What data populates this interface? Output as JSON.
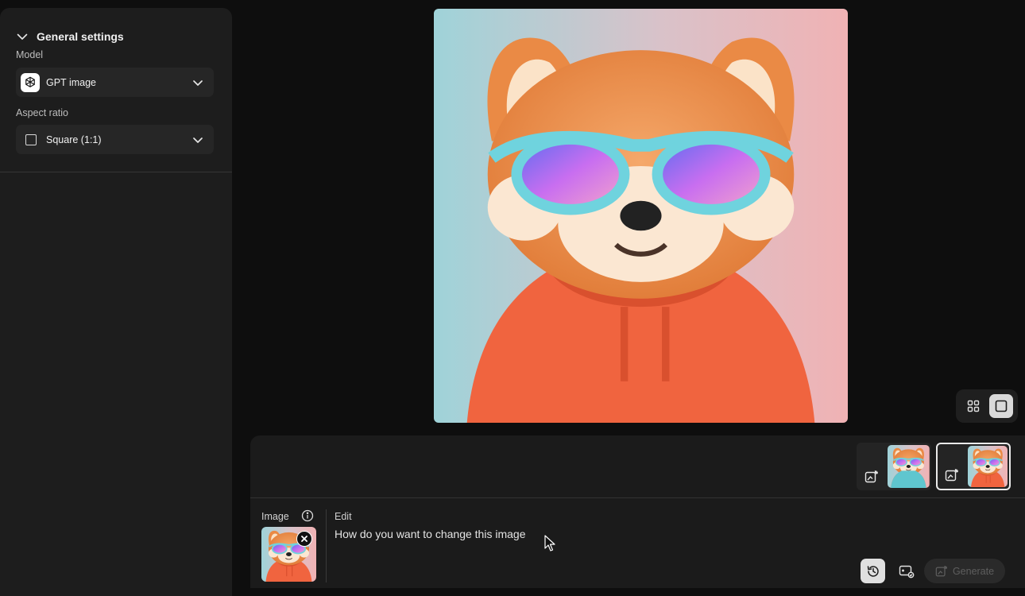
{
  "sidebar": {
    "section_title": "General settings",
    "model_label": "Model",
    "model_value": "GPT image",
    "aspect_label": "Aspect ratio",
    "aspect_value": "Square (1:1)"
  },
  "prompt_panel": {
    "image_label": "Image",
    "edit_label": "Edit",
    "prompt_placeholder": "How do you want to change this image",
    "generate_label": "Generate"
  },
  "icons": [
    "chevron-down-icon",
    "openai-logo-icon",
    "square-icon",
    "grid-view-icon",
    "single-view-icon",
    "edit-image-icon",
    "info-icon",
    "close-icon",
    "history-icon",
    "image-settings-icon",
    "generate-icon",
    "mouse-cursor-icon"
  ],
  "colors": {
    "background": "#0e0e0e",
    "panel": "#1d1d1d",
    "hoodie": "#f0643f",
    "glasses_frame": "#6fd3de"
  }
}
